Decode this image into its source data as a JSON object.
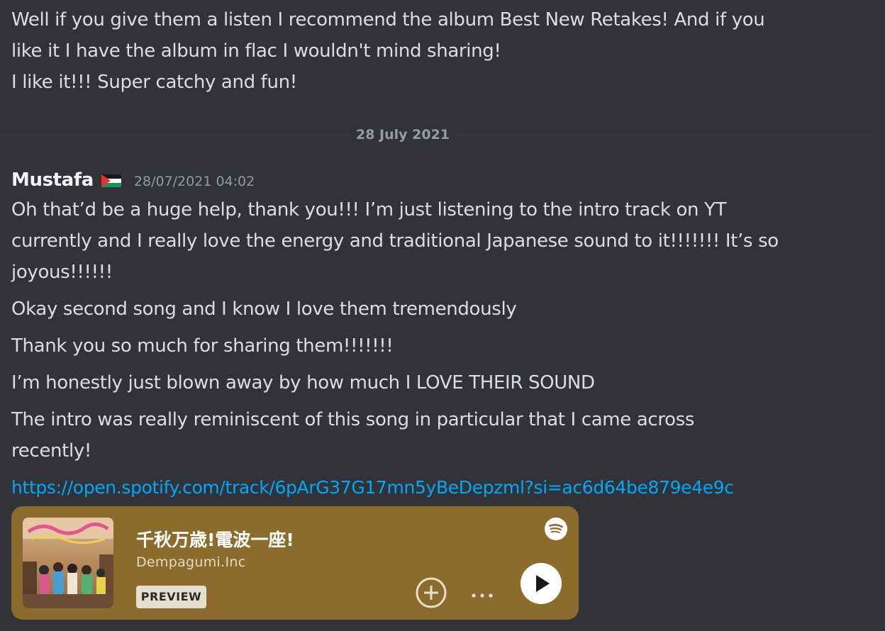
{
  "previous_message": {
    "lines": [
      "Well if you give them a listen I recommend the album Best New Retakes! And if you",
      "like it I have the album in flac I wouldn't mind sharing!",
      "I like it!!! Super catchy and fun!"
    ]
  },
  "date_divider": "28 July 2021",
  "message": {
    "author": "Mustafa",
    "flag_icon": "palestine-flag-icon",
    "timestamp": "28/07/2021 04:02",
    "paragraph1": [
      "Oh that’d be a huge help, thank you!!! I’m just listening to the intro track on YT",
      "currently and I really love the energy and traditional Japanese sound to it!!!!!!! It’s so",
      "joyous!!!!!!"
    ],
    "line2": "Okay second song and I know I love them tremendously",
    "line3": "Thank you so much for sharing them!!!!!!!",
    "line4": "I’m honestly just blown away by how much I LOVE THEIR SOUND",
    "paragraph5": [
      "The intro was really reminiscent of this song in particular that I came across",
      "recently!"
    ],
    "link": "https://open.spotify.com/track/6pArG37G17mn5yBeDepzml?si=ac6d64be879e4e9c"
  },
  "embed": {
    "title": "千秋万歳!電波一座!",
    "artist": "Dempagumi.Inc",
    "badge": "PREVIEW",
    "background_color": "#8c6c2c",
    "icons": {
      "service": "spotify-icon",
      "add": "add-circle-icon",
      "more": "more-horizontal-icon",
      "play": "play-icon"
    }
  },
  "colors": {
    "background": "#313338",
    "text": "#dbdee1",
    "muted": "#949ba4",
    "link": "#00a8fc"
  }
}
